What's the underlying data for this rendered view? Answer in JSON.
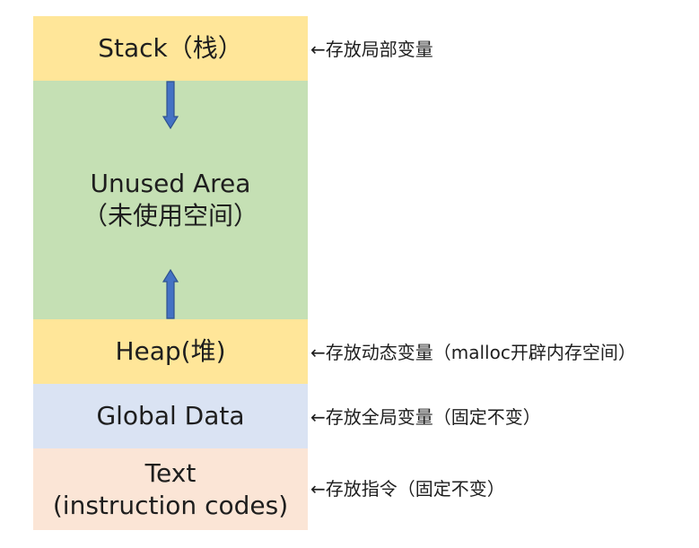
{
  "segments": {
    "stack": {
      "label": "Stack（栈）"
    },
    "unused": {
      "line1": "Unused Area",
      "line2": "（未使用空间）"
    },
    "heap": {
      "label": "Heap(堆)"
    },
    "global": {
      "label": "Global Data"
    },
    "text": {
      "line1": "Text",
      "line2": "(instruction codes)"
    }
  },
  "notes": {
    "stack": "←存放局部变量",
    "heap": "←存放动态变量（malloc开辟内存空间）",
    "global": "←存放全局变量（固定不变）",
    "text": "←存放指令（固定不变）"
  },
  "colors": {
    "stack_heap": "#ffe699",
    "unused": "#c5e0b4",
    "global": "#dae3f3",
    "text": "#fbe5d6",
    "arrow": "#4472c4"
  },
  "arrows": {
    "stack_growth": "down",
    "heap_growth": "up"
  }
}
